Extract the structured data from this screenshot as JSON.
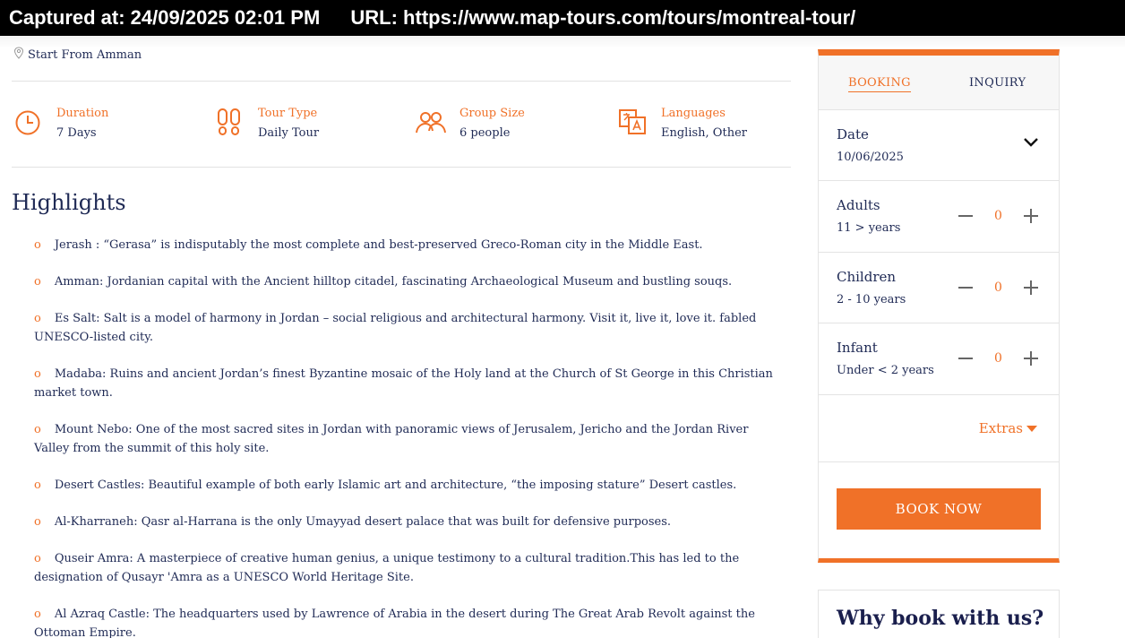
{
  "capture": {
    "captured_at": "Captured at: 24/09/2025 02:01 PM",
    "url": "URL: https://www.map-tours.com/tours/montreal-tour/"
  },
  "tour": {
    "start_from": "Start From Amman",
    "facts": [
      {
        "icon": "clock-icon",
        "label": "Duration",
        "value": "7 Days"
      },
      {
        "icon": "footprints-icon",
        "label": "Tour Type",
        "value": "Daily Tour"
      },
      {
        "icon": "group-icon",
        "label": "Group Size",
        "value": "6 people"
      },
      {
        "icon": "translate-icon",
        "label": "Languages",
        "value": "English, Other"
      }
    ]
  },
  "highlights": {
    "title": "Highlights",
    "bullet": "o",
    "items": [
      "Jerash : “Gerasa” is indisputably the most complete and best-preserved Greco-Roman city in the Middle East.",
      "Amman: Jordanian capital with the Ancient hilltop citadel, fascinating Archaeological Museum and bustling souqs.",
      "Es Salt: Salt is a model of harmony in Jordan – social religious and architectural harmony. Visit it, live it, love it. fabled UNESCO-listed city.",
      "Madaba: Ruins and ancient Jordan’s finest Byzantine mosaic of the Holy land at the Church of St George in this Christian market town.",
      "Mount Nebo: One of the most sacred sites in Jordan with panoramic views of Jerusalem, Jericho and the Jordan River Valley from the summit of this holy site.",
      "Desert Castles: Beautiful example of both early Islamic art and architecture, “the imposing stature” Desert castles.",
      "Al-Kharraneh: Qasr al-Harrana is the only Umayyad desert palace that was built for defensive purposes.",
      "Quseir Amra: A masterpiece of creative human genius, a unique testimony to a cultural tradition.This has led to the designation of Qusayr 'Amra as a UNESCO World Heritage Site.",
      "Al Azraq Castle: The headquarters used by Lawrence of Arabia in the desert during The Great Arab Revolt against the Ottoman Empire."
    ]
  },
  "booking": {
    "tabs": {
      "booking": "BOOKING",
      "inquiry": "INQUIRY"
    },
    "date": {
      "label": "Date",
      "value": "10/06/2025"
    },
    "adults": {
      "label": "Adults",
      "sub": "11 > years",
      "count": "0"
    },
    "children": {
      "label": "Children",
      "sub": "2 - 10 years",
      "count": "0"
    },
    "infant": {
      "label": "Infant",
      "sub": "Under < 2 years",
      "count": "0"
    },
    "extras": "Extras",
    "book_now": "BOOK NOW"
  },
  "why": {
    "title": "Why book with us?"
  },
  "colors": {
    "accent": "#f07128",
    "text": "#1f2a55"
  }
}
